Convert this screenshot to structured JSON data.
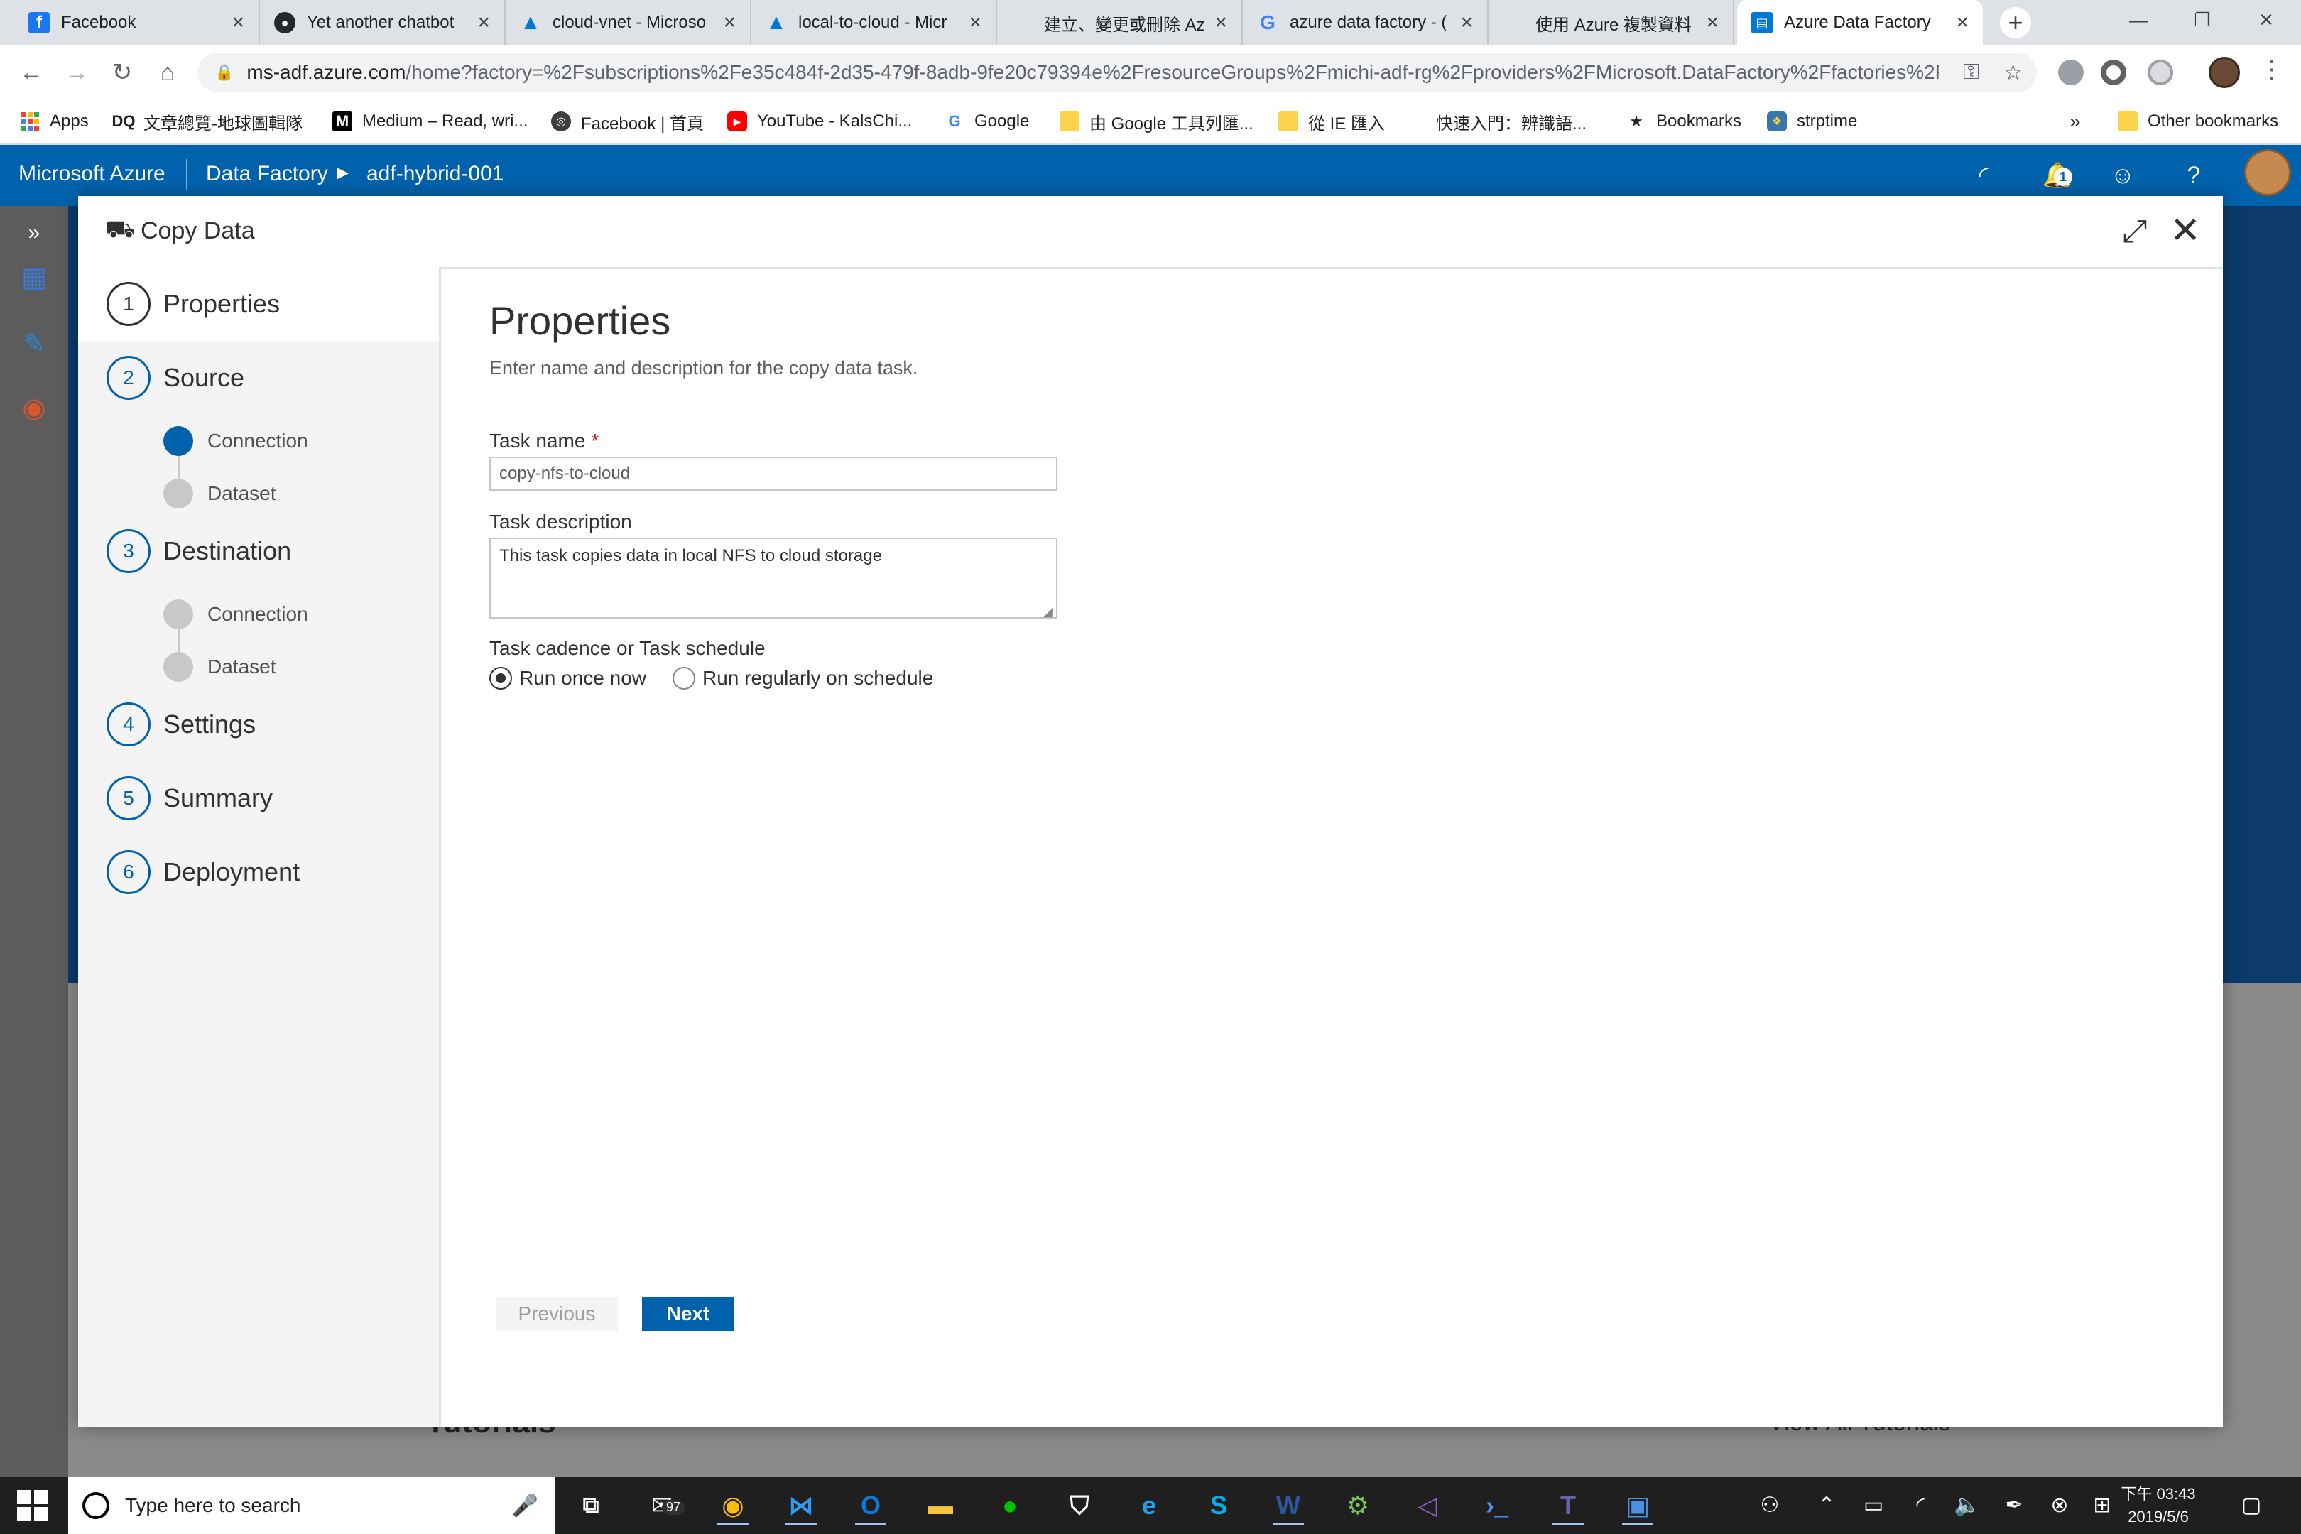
{
  "browser": {
    "tabs": [
      {
        "title": "Facebook",
        "icon": "facebook-icon"
      },
      {
        "title": "Yet another chatbot",
        "icon": "github-icon"
      },
      {
        "title": "cloud-vnet - Microso",
        "icon": "azure-icon"
      },
      {
        "title": "local-to-cloud - Micr",
        "icon": "azure-icon"
      },
      {
        "title": "建立、變更或刪除 Az",
        "icon": "microsoft-icon"
      },
      {
        "title": "azure data factory - (",
        "icon": "google-icon"
      },
      {
        "title": "使用 Azure 複製資料",
        "icon": "microsoft-icon"
      },
      {
        "title": "Azure Data Factory",
        "icon": "data-factory-icon",
        "active": true
      }
    ],
    "url_host": "ms-adf.azure.com",
    "url_rest": "/home?factory=%2Fsubscriptions%2Fe35c484f-2d35-479f-8adb-9fe20c79394e%2FresourceGroups%2Fmichi-adf-rg%2Fproviders%2FMicrosoft.DataFactory%2Ffactories%2Fa...",
    "bookmarks": [
      {
        "label": "Apps"
      },
      {
        "label": "文章總覽-地球圖輯隊",
        "prefix": "DQ"
      },
      {
        "label": "Medium – Read, wri...",
        "prefix": "M"
      },
      {
        "label": "Facebook | 首頁"
      },
      {
        "label": "YouTube - KalsChi..."
      },
      {
        "label": "Google",
        "prefix": "G"
      },
      {
        "label": "由 Google 工具列匯..."
      },
      {
        "label": "從 IE 匯入"
      },
      {
        "label": "快速入門：辨識語..."
      },
      {
        "label": "Bookmarks",
        "prefix": "★"
      },
      {
        "label": "strptime"
      }
    ],
    "bookmarks_overflow": "»",
    "other_bookmarks": "Other bookmarks"
  },
  "azure_header": {
    "brand": "Microsoft Azure",
    "service": "Data Factory",
    "factory": "adf-hybrid-001",
    "notification_count": "1",
    "accent": "#0062ad"
  },
  "dialog": {
    "title": "Copy Data",
    "steps": [
      {
        "num": "1",
        "label": "Properties"
      },
      {
        "num": "2",
        "label": "Source",
        "substeps": [
          "Connection",
          "Dataset"
        ]
      },
      {
        "num": "3",
        "label": "Destination",
        "substeps": [
          "Connection",
          "Dataset"
        ]
      },
      {
        "num": "4",
        "label": "Settings"
      },
      {
        "num": "5",
        "label": "Summary"
      },
      {
        "num": "6",
        "label": "Deployment"
      }
    ],
    "active_step": "Properties",
    "properties": {
      "heading": "Properties",
      "description": "Enter name and description for the copy data task.",
      "task_name_label": "Task name",
      "required_marker": "*",
      "task_name_value": "copy-nfs-to-cloud",
      "task_description_label": "Task description",
      "task_description_value": "This task copies data in local NFS to cloud storage",
      "cadence_label": "Task cadence or Task schedule",
      "cadence_options": [
        "Run once now",
        "Run regularly on schedule"
      ],
      "cadence_selected": "Run once now"
    },
    "previous_label": "Previous",
    "next_label": "Next"
  },
  "background": {
    "tutorials": "Tutorials",
    "view_all": "View All Tutorials"
  },
  "taskbar": {
    "search_placeholder": "Type here to search",
    "mail_count": "97",
    "clock_time": "下午 03:43",
    "clock_date": "2019/5/6"
  }
}
